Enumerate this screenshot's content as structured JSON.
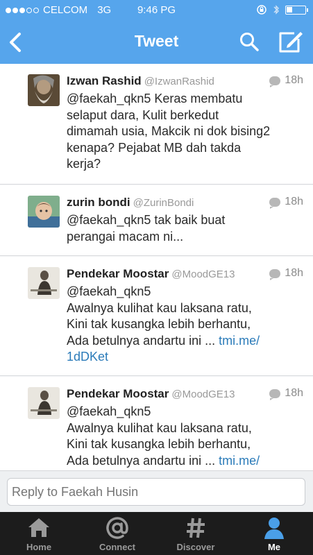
{
  "status": {
    "carrier": "CELCOM",
    "network": "3G",
    "time": "9:46 PG",
    "signal_bars": 3,
    "battery_level": 0.3
  },
  "nav": {
    "title": "Tweet"
  },
  "tweets": [
    {
      "name": "Izwan Rashid",
      "handle": "@IzwanRashid",
      "age": "18h",
      "lines": [
        "@faekah_qkn5 Keras membatu",
        "selaput dara, Kulit berkedut",
        "dimamah usia, Makcik ni dok bising2",
        "kenapa? Pejabat MB dah takda",
        "kerja?"
      ]
    },
    {
      "name": "zurin bondi",
      "handle": "@ZurinBondi",
      "age": "18h",
      "lines": [
        "@faekah_qkn5 tak baik buat",
        "perangai macam ni..."
      ]
    },
    {
      "name": "Pendekar Moostar",
      "handle": "@MoodGE13",
      "age": "18h",
      "lines": [
        "@faekah_qkn5",
        "Awalnya kulihat kau laksana ratu,",
        "Kini tak kusangka lebih berhantu,",
        "Ada betulnya andartu ini ..."
      ],
      "link": [
        "tmi.me/",
        "1dDKet"
      ]
    },
    {
      "name": "Pendekar Moostar",
      "handle": "@MoodGE13",
      "age": "18h",
      "lines": [
        "@faekah_qkn5",
        "Awalnya kulihat kau laksana ratu,",
        "Kini tak kusangka lebih berhantu,",
        "Ada betulnya andartu ini ..."
      ],
      "link": [
        "tmi.me/"
      ]
    }
  ],
  "reply": {
    "placeholder": "Reply to Faekah Husin"
  },
  "tabs": [
    {
      "label": "Home",
      "icon": "home-icon"
    },
    {
      "label": "Connect",
      "icon": "at-icon"
    },
    {
      "label": "Discover",
      "icon": "hash-icon"
    },
    {
      "label": "Me",
      "icon": "person-icon",
      "active": true
    }
  ],
  "colors": {
    "accent": "#56a5ec",
    "link": "#2b7bb9",
    "tabbar": "#1c1c1c"
  }
}
